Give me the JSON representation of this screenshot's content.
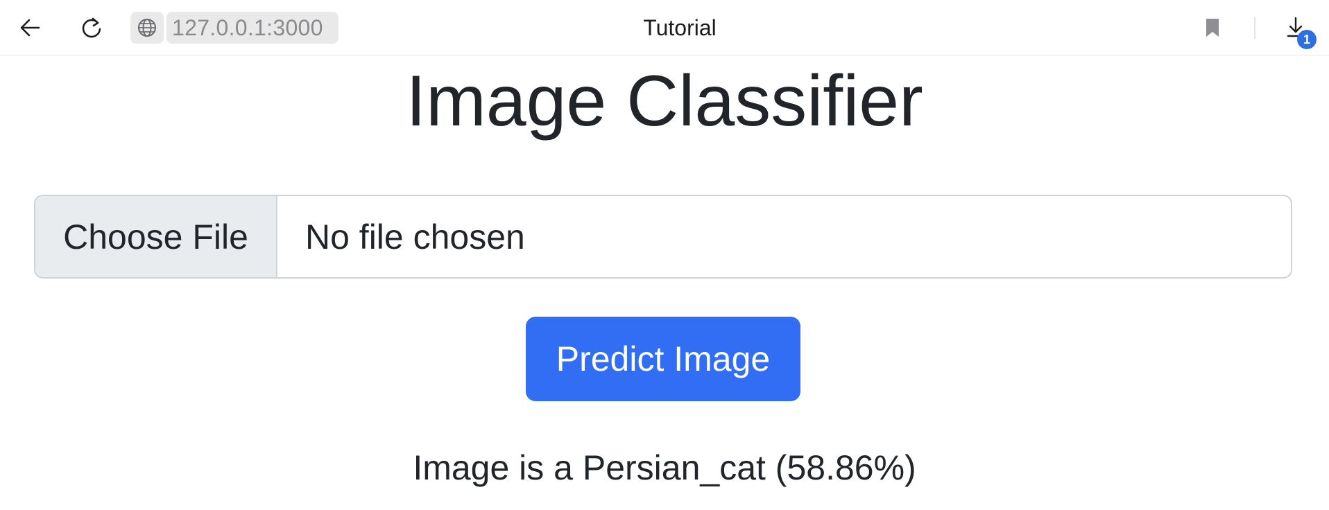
{
  "browser": {
    "url": "127.0.0.1:3000",
    "tab_title": "Tutorial",
    "download_badge": "1",
    "icons": {
      "back": "arrow-left-icon",
      "reload": "reload-icon",
      "site": "globe-icon",
      "bookmark": "bookmark-icon",
      "download": "download-icon"
    },
    "accent_color": "#2f6fe0"
  },
  "page": {
    "title": "Image Classifier",
    "file_input": {
      "button_label": "Choose File",
      "status": "No file chosen"
    },
    "predict_button": {
      "label": "Predict Image",
      "color": "#316ef3"
    },
    "result_text": "Image is a Persian_cat (58.86%)"
  }
}
